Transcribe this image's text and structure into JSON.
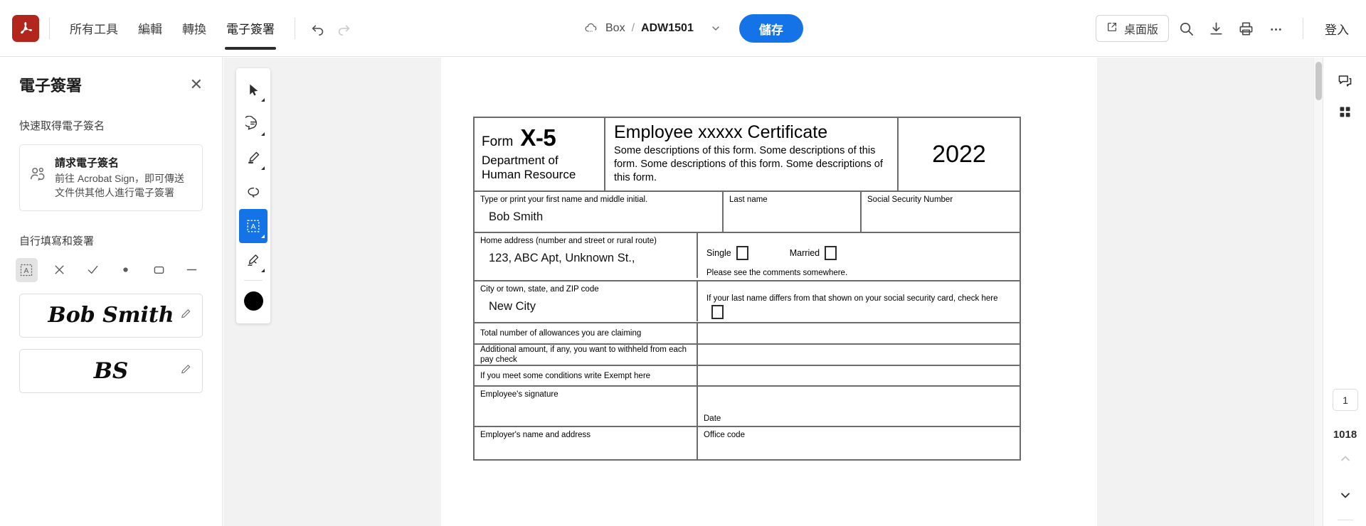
{
  "topbar": {
    "logo": "acrobat-logo",
    "tabs": [
      {
        "label": "所有工具",
        "active": false
      },
      {
        "label": "編輯",
        "active": false
      },
      {
        "label": "轉換",
        "active": false
      },
      {
        "label": "電子簽署",
        "active": true
      }
    ],
    "undo_icon": "undo-icon",
    "redo_icon": "redo-icon",
    "breadcrumb": {
      "cloud_icon": "cloud-icon",
      "storage": "Box",
      "separator": "/",
      "filename": "ADW1501",
      "chevron_icon": "chevron-down-icon"
    },
    "save_label": "儲存",
    "save_color": "#1473e6",
    "desktop_label": "桌面版",
    "desktop_icon": "external-link-icon",
    "search_icon": "search-icon",
    "download_icon": "download-icon",
    "print_icon": "print-icon",
    "more_icon": "more-horizontal-icon",
    "signin_label": "登入"
  },
  "left_panel": {
    "title": "電子簽署",
    "close_icon": "close-icon",
    "quick_section_label": "快速取得電子簽名",
    "request_card": {
      "icon": "request-signature-icon",
      "title": "請求電子簽名",
      "description": "前往 Acrobat Sign，即可傳送文件供其他人進行電子簽署"
    },
    "fill_section_label": "自行填寫和簽署",
    "tools": [
      {
        "name": "add-text-tool",
        "glyph": "A",
        "selected": true
      },
      {
        "name": "cross-mark-tool",
        "glyph": "✕",
        "selected": false
      },
      {
        "name": "check-mark-tool",
        "glyph": "✓",
        "selected": false
      },
      {
        "name": "dot-tool",
        "glyph": "●",
        "selected": false
      },
      {
        "name": "rectangle-tool",
        "glyph": "▭",
        "selected": false
      },
      {
        "name": "line-tool",
        "glyph": "—",
        "selected": false
      }
    ],
    "signatures": [
      {
        "text": "Bob Smith",
        "type": "full",
        "edit_icon": "pencil-icon"
      },
      {
        "text": "BS",
        "type": "initials",
        "edit_icon": "pencil-icon"
      }
    ]
  },
  "vertical_toolbar": {
    "items": [
      {
        "name": "select-tool",
        "icon": "cursor-arrow-icon",
        "has_caret": true,
        "active": false
      },
      {
        "name": "comment-tool",
        "icon": "comment-bubble-icon",
        "has_caret": true,
        "active": false
      },
      {
        "name": "highlight-tool",
        "icon": "highlighter-icon",
        "has_caret": true,
        "active": false
      },
      {
        "name": "draw-tool",
        "icon": "lasso-icon",
        "has_caret": false,
        "active": false
      },
      {
        "name": "fill-and-sign-tool",
        "icon": "add-text-box-icon",
        "has_caret": true,
        "active": true
      },
      {
        "name": "signature-tool",
        "icon": "sign-pen-icon",
        "has_caret": true,
        "active": false
      }
    ],
    "color_swatch": "#000000"
  },
  "right_rail": {
    "comment_icon": "comments-panel-icon",
    "thumbnails_icon": "page-thumbnails-icon",
    "current_page": "1",
    "total_pages": "1018",
    "prev_icon": "chevron-up-icon",
    "next_icon": "chevron-down-icon"
  },
  "document": {
    "header": {
      "form_word": "Form",
      "form_code": "X-5",
      "department": "Department of\nHuman Resource",
      "title": "Employee xxxxx Certificate",
      "description": "Some descriptions of this form. Some descriptions of this form. Some descriptions of this form. Some descriptions of this form.",
      "year": "2022"
    },
    "rows": {
      "first_name_label": "Type or print your first name and middle initial.",
      "first_name_value": "Bob Smith",
      "last_name_label": "Last name",
      "last_name_value": "",
      "ssn_label": "Social Security Number",
      "ssn_value": "",
      "home_address_label": "Home address (number and street or rural route)",
      "home_address_value": "123, ABC Apt, Unknown St.,",
      "single_label": "Single",
      "married_label": "Married",
      "comments_note": "Please see the comments somewhere.",
      "city_label": "City or town, state, and ZIP code",
      "city_value": "New City",
      "lastname_differs_note": "If your last name differs from that shown on your social security card, check here",
      "allowances_label": "Total number of allowances you are claiming",
      "allowances_value": "",
      "additional_amount_label": "Additional amount, if any, you want to withheld from each pay check",
      "additional_amount_value": "",
      "exempt_label": "If you meet some conditions write Exempt here",
      "exempt_value": "",
      "employee_signature_label": "Employee's signature",
      "date_label": "Date",
      "employer_label": "Employer's name and address",
      "office_code_label": "Office code"
    }
  }
}
